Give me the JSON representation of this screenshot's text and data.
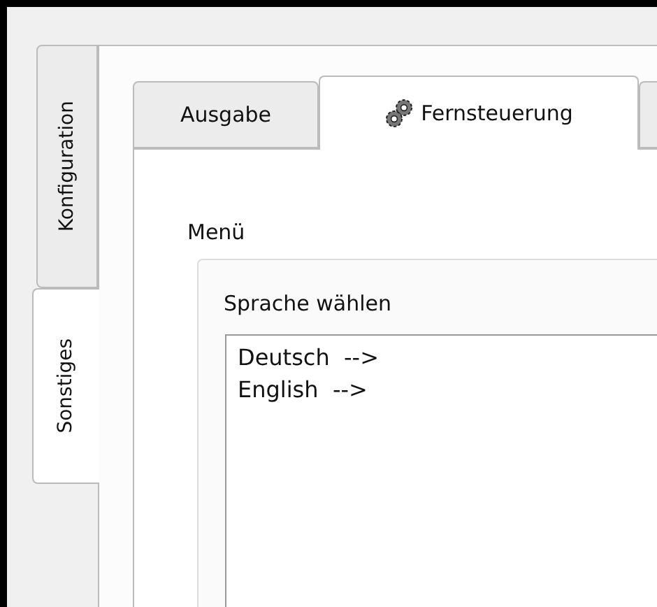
{
  "side_tabs": [
    {
      "label": "Konfiguration",
      "selected": false
    },
    {
      "label": "Sonstiges",
      "selected": true
    }
  ],
  "tabs": [
    {
      "label": "Ausgabe",
      "selected": false,
      "icon": false
    },
    {
      "label": "Fernsteuerung",
      "selected": true,
      "icon": true
    }
  ],
  "section_title": "Menü",
  "group": {
    "title": "Sprache wählen",
    "items": [
      "Deutsch  -->",
      "English  -->"
    ]
  }
}
